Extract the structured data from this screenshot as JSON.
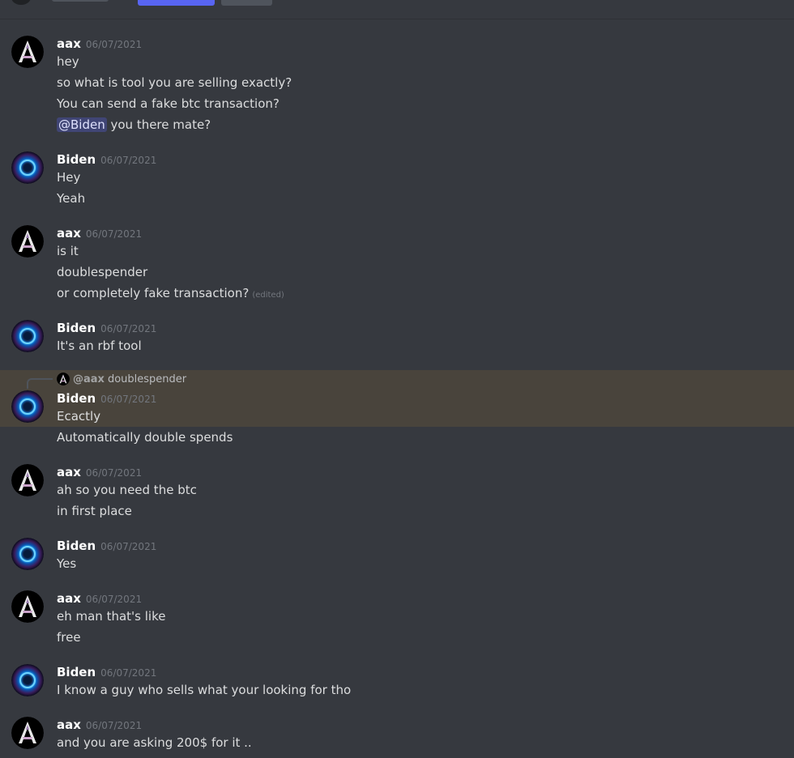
{
  "users": {
    "aax": {
      "name": "aax",
      "avatar_icon": "aax-letter-a-icon",
      "avatar_color": "#000000"
    },
    "biden": {
      "name": "Biden",
      "avatar_icon": "blue-vortex-icon",
      "avatar_color": "#1e90ff"
    }
  },
  "messages": [
    {
      "author": "aax",
      "timestamp": "06/07/2021",
      "lines": [
        "hey",
        "so what is tool you are selling exactly?",
        "You can send a fake btc transaction?"
      ],
      "mention_line": {
        "mention": "@Biden",
        "text": " you there mate?"
      }
    },
    {
      "author": "Biden",
      "timestamp": "06/07/2021",
      "lines": [
        "Hey",
        "Yeah"
      ]
    },
    {
      "author": "aax",
      "timestamp": "06/07/2021",
      "lines": [
        "is it",
        "doublespender",
        "or completely fake transaction?"
      ],
      "edited_label": "(edited)"
    },
    {
      "author": "Biden",
      "timestamp": "06/07/2021",
      "lines": [
        "It's an rbf tool"
      ]
    },
    {
      "author": "Biden",
      "timestamp": "06/07/2021",
      "reply": {
        "author": "@aax",
        "text": "doublespender"
      },
      "lines": [
        "Ecactly",
        "Automatically double spends"
      ]
    },
    {
      "author": "aax",
      "timestamp": "06/07/2021",
      "lines": [
        "ah so you need the btc",
        "in first place"
      ]
    },
    {
      "author": "Biden",
      "timestamp": "06/07/2021",
      "lines": [
        "Yes"
      ]
    },
    {
      "author": "aax",
      "timestamp": "06/07/2021",
      "lines": [
        "eh man that's like",
        "free"
      ]
    },
    {
      "author": "Biden",
      "timestamp": "06/07/2021",
      "lines": [
        "I know a guy who sells what your looking for tho"
      ]
    },
    {
      "author": "aax",
      "timestamp": "06/07/2021",
      "lines": [
        "and you are asking 200$ for it .."
      ]
    }
  ],
  "colors": {
    "background": "#36393f",
    "highlight": "#49443c",
    "mention_bg": "#5865f2",
    "accent": "#5865f2"
  }
}
